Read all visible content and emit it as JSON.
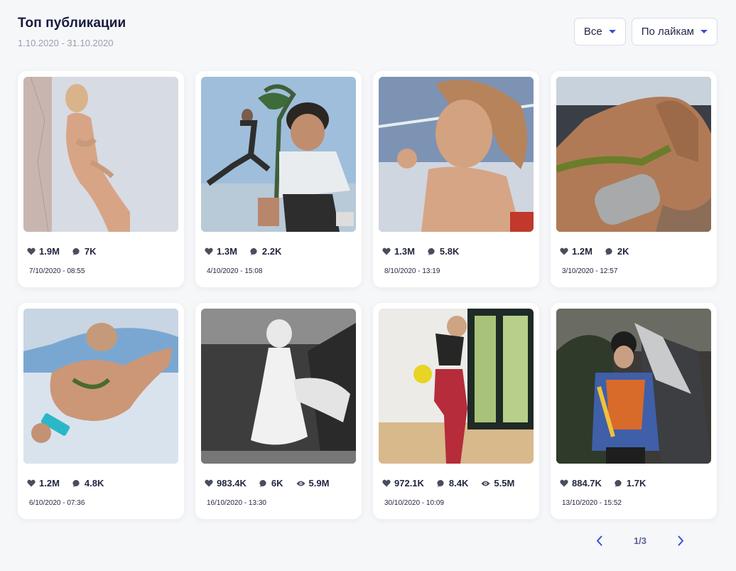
{
  "header": {
    "title": "Топ публикации",
    "date_range": "1.10.2020 - 31.10.2020"
  },
  "filters": {
    "type_label": "Все",
    "sort_label": "По лайкам"
  },
  "colors": {
    "accent": "#3b4ed6",
    "icon": "#4a4d5c"
  },
  "posts": [
    {
      "likes": "1.9M",
      "comments": "7K",
      "views": "",
      "date": "7/10/2020 - 08:55"
    },
    {
      "likes": "1.3M",
      "comments": "2.2K",
      "views": "",
      "date": "4/10/2020 - 15:08"
    },
    {
      "likes": "1.3M",
      "comments": "5.8K",
      "views": "",
      "date": "8/10/2020 - 13:19"
    },
    {
      "likes": "1.2M",
      "comments": "2K",
      "views": "",
      "date": "3/10/2020 - 12:57"
    },
    {
      "likes": "1.2M",
      "comments": "4.8K",
      "views": "",
      "date": "6/10/2020 - 07:36"
    },
    {
      "likes": "983.4K",
      "comments": "6K",
      "views": "5.9M",
      "date": "16/10/2020 - 13:30"
    },
    {
      "likes": "972.1K",
      "comments": "8.4K",
      "views": "5.5M",
      "date": "30/10/2020 - 10:09"
    },
    {
      "likes": "884.7K",
      "comments": "1.7K",
      "views": "",
      "date": "13/10/2020 - 15:52"
    }
  ],
  "pagination": {
    "page_label": "1/3"
  },
  "icons": {
    "like": "heart-icon",
    "comment": "comment-icon",
    "views": "eye-icon",
    "prev": "chevron-left-icon",
    "next": "chevron-right-icon"
  }
}
